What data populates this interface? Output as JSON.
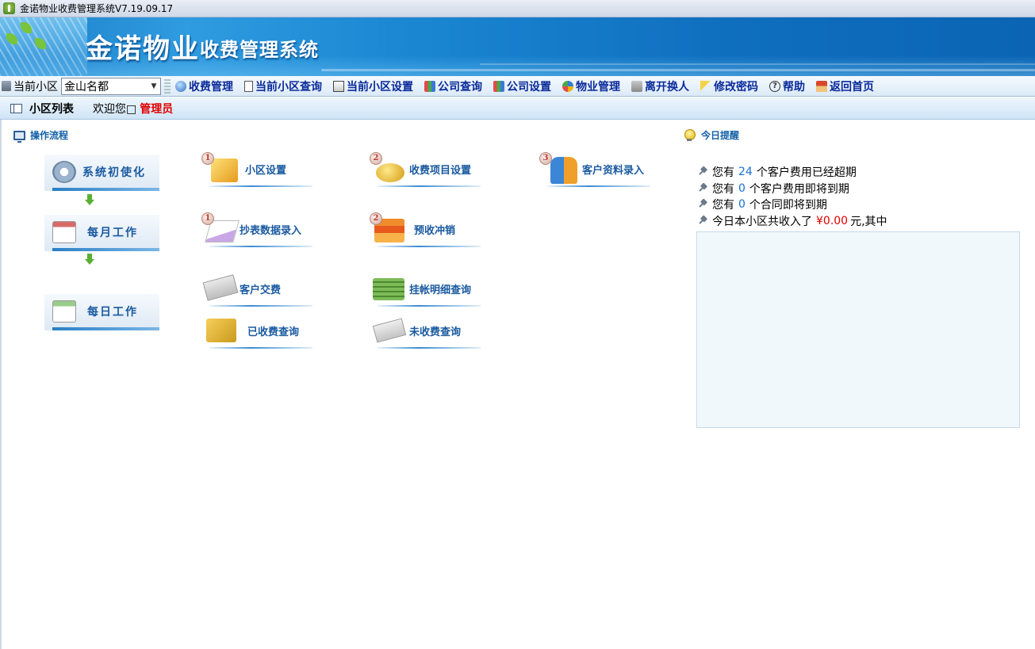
{
  "window": {
    "title": "金诺物业收费管理系统V7.19.09.17"
  },
  "banner": {
    "brand": "金诺物业",
    "subtitle": "收费管理系统"
  },
  "toolbar": {
    "current_label": "当前小区",
    "current_value": "金山名都",
    "items": [
      {
        "label": "收费管理",
        "icon": "fee-management-icon"
      },
      {
        "label": "当前小区查询",
        "icon": "document-icon"
      },
      {
        "label": "当前小区设置",
        "icon": "settings-icon"
      },
      {
        "label": "公司查询",
        "icon": "book-icon"
      },
      {
        "label": "公司设置",
        "icon": "book-icon"
      },
      {
        "label": "物业管理",
        "icon": "property-icon"
      },
      {
        "label": "离开换人",
        "icon": "switch-user-icon"
      },
      {
        "label": "修改密码",
        "icon": "key-icon"
      },
      {
        "label": "帮助",
        "icon": "help-icon"
      },
      {
        "label": "返回首页",
        "icon": "home-icon"
      }
    ]
  },
  "section": {
    "title": "小区列表",
    "welcome": "欢迎您□",
    "user": "管理员"
  },
  "flow": {
    "heading": "操作流程",
    "stages": [
      {
        "label": "系统初使化"
      },
      {
        "label": "每月工作"
      },
      {
        "label": "每日工作"
      }
    ],
    "ops": [
      {
        "num": "1",
        "label": "小区设置"
      },
      {
        "num": "2",
        "label": "收费项目设置"
      },
      {
        "num": "3",
        "label": "客户资料录入"
      },
      {
        "num": "1",
        "label": "抄表数据录入"
      },
      {
        "num": "2",
        "label": "预收冲销"
      },
      {
        "label": "客户交费"
      },
      {
        "label": "挂帐明细查询"
      },
      {
        "label": "已收费查询"
      },
      {
        "label": "未收费查询"
      }
    ]
  },
  "reminder": {
    "heading": "今日提醒",
    "overdue": {
      "pre": "您有",
      "count": "24",
      "post": "个客户费用已经超期"
    },
    "expiring": {
      "pre": "您有",
      "count": "0",
      "post": "个客户费用即将到期"
    },
    "contracts": {
      "pre": "您有",
      "count": "0",
      "post": "个合同即将到期"
    },
    "income": {
      "pre": "今日本小区共收入了",
      "amount": "¥0.00",
      "post": "元,其中"
    }
  },
  "colors": {
    "accent": "#1a5aa0",
    "nav_text": "#0a2a9a",
    "alert": "#e00000",
    "count": "#1a6fd0"
  }
}
